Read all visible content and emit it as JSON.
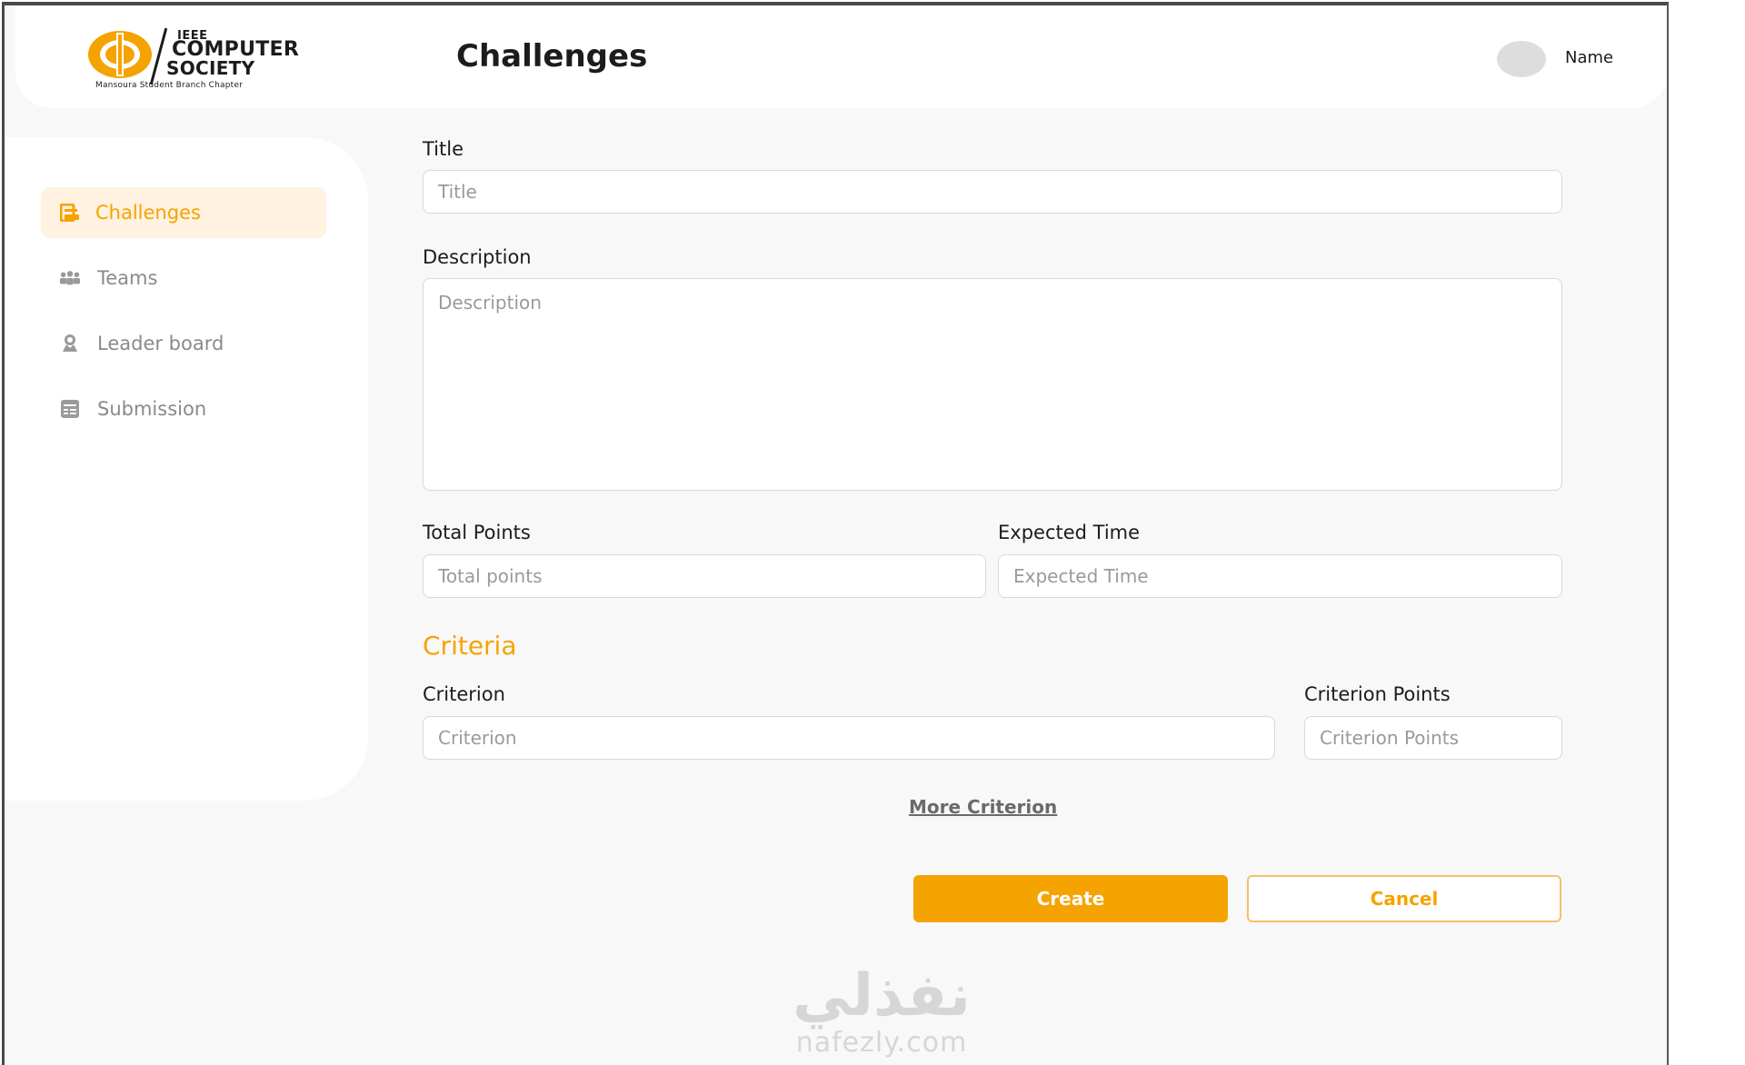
{
  "brand": {
    "ieee": "IEEE",
    "computer": "COMPUTER",
    "society": "SOCIETY",
    "subtitle": "Mansoura Student Branch Chapter",
    "accent_color": "#f5a300"
  },
  "header": {
    "title": "Challenges",
    "user_name": "Name"
  },
  "sidebar": {
    "items": [
      {
        "label": "Challenges",
        "icon": "challenges-icon",
        "active": true
      },
      {
        "label": "Teams",
        "icon": "teams-icon",
        "active": false
      },
      {
        "label": "Leader board",
        "icon": "leaderboard-icon",
        "active": false
      },
      {
        "label": "Submission",
        "icon": "submission-icon",
        "active": false
      }
    ]
  },
  "form": {
    "title_label": "Title",
    "title_placeholder": "Title",
    "description_label": "Description",
    "description_placeholder": "Description",
    "total_points_label": "Total Points",
    "total_points_placeholder": "Total points",
    "expected_time_label": "Expected Time",
    "expected_time_placeholder": "Expected Time",
    "criteria_heading": "Criteria",
    "criterion_label": "Criterion",
    "criterion_placeholder": "Criterion",
    "criterion_points_label": "Criterion Points",
    "criterion_points_placeholder": "Criterion Points",
    "more_criterion": "More Criterion",
    "create_label": "Create",
    "cancel_label": "Cancel"
  },
  "watermark": {
    "arabic": "نفذلي",
    "latin": "nafezly.com"
  }
}
